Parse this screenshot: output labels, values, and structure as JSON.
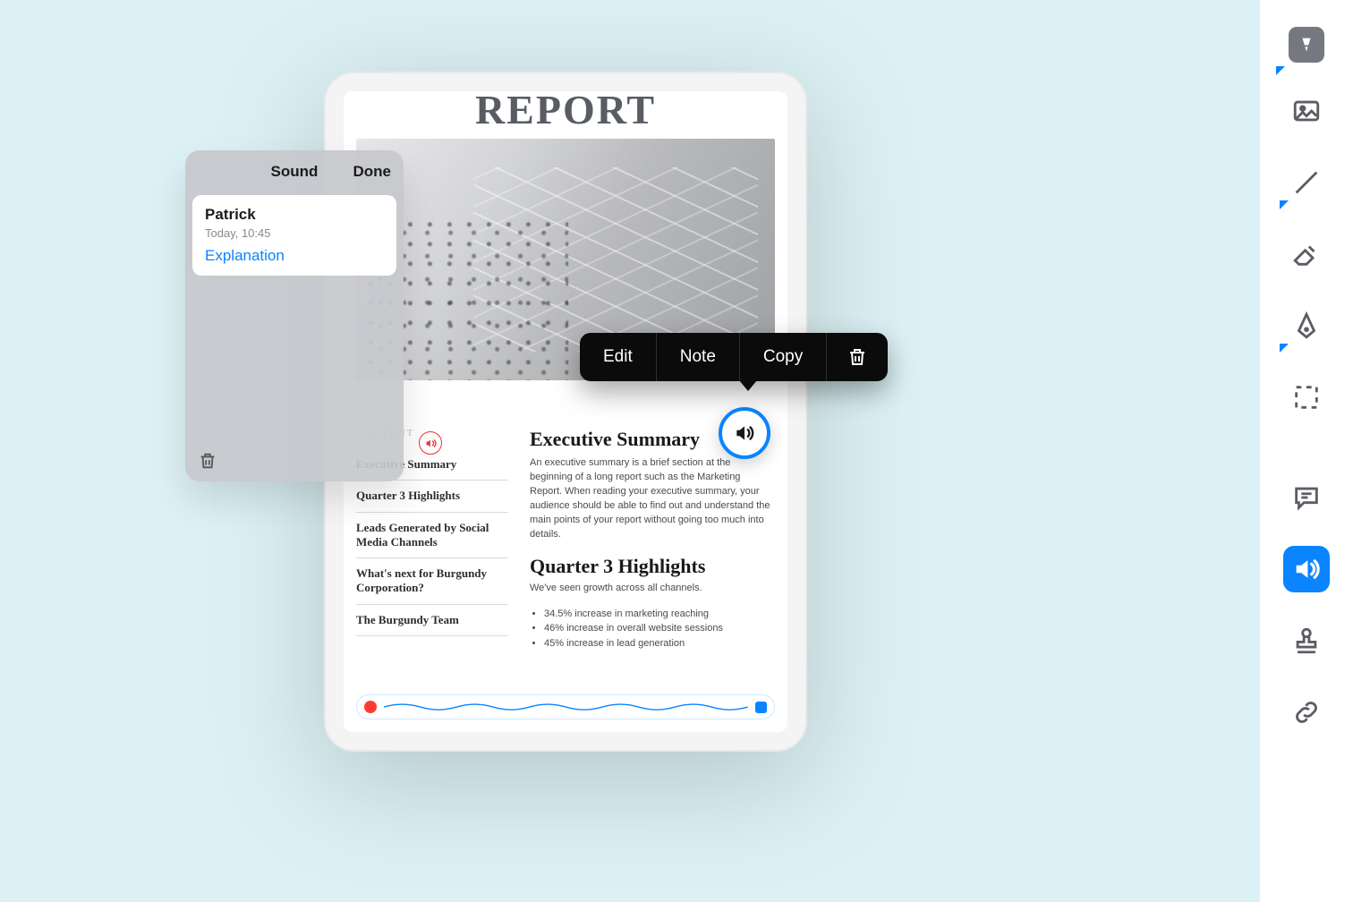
{
  "colors": {
    "accent": "#0a84ff",
    "background": "#dcf1f5"
  },
  "popover": {
    "title": "Sound",
    "done": "Done",
    "note": {
      "author": "Patrick",
      "timestamp": "Today, 10:45",
      "link_label": "Explanation"
    }
  },
  "action_menu": {
    "edit": "Edit",
    "note": "Note",
    "copy": "Copy"
  },
  "document": {
    "title": "REPORT",
    "toc_heading": "CONTENT",
    "toc": [
      "Executive Summary",
      "Quarter 3 Highlights",
      "Leads Generated by Social Media Channels",
      "What's next for Burgundy Corporation?",
      "The Burgundy Team"
    ],
    "section1_title": "Executive Summary",
    "section1_body": "An executive summary is a brief section at the beginning of a long report such as the Marketing Report. When reading your executive summary, your audience should be able to find out and understand the main points of your report without going too much into details.",
    "section2_title": "Quarter 3 Highlights",
    "section2_intro": "We've seen growth across all channels.",
    "section2_bullets": [
      "34.5% increase in marketing reaching",
      "46% increase in overall website sessions",
      "45% increase in lead generation"
    ]
  },
  "toolbar_icons": [
    "text-tool-icon",
    "image-tool-icon",
    "line-tool-icon",
    "eraser-tool-icon",
    "pen-tool-icon",
    "selection-tool-icon",
    "comment-tool-icon",
    "sound-tool-icon",
    "stamp-tool-icon",
    "link-tool-icon"
  ]
}
